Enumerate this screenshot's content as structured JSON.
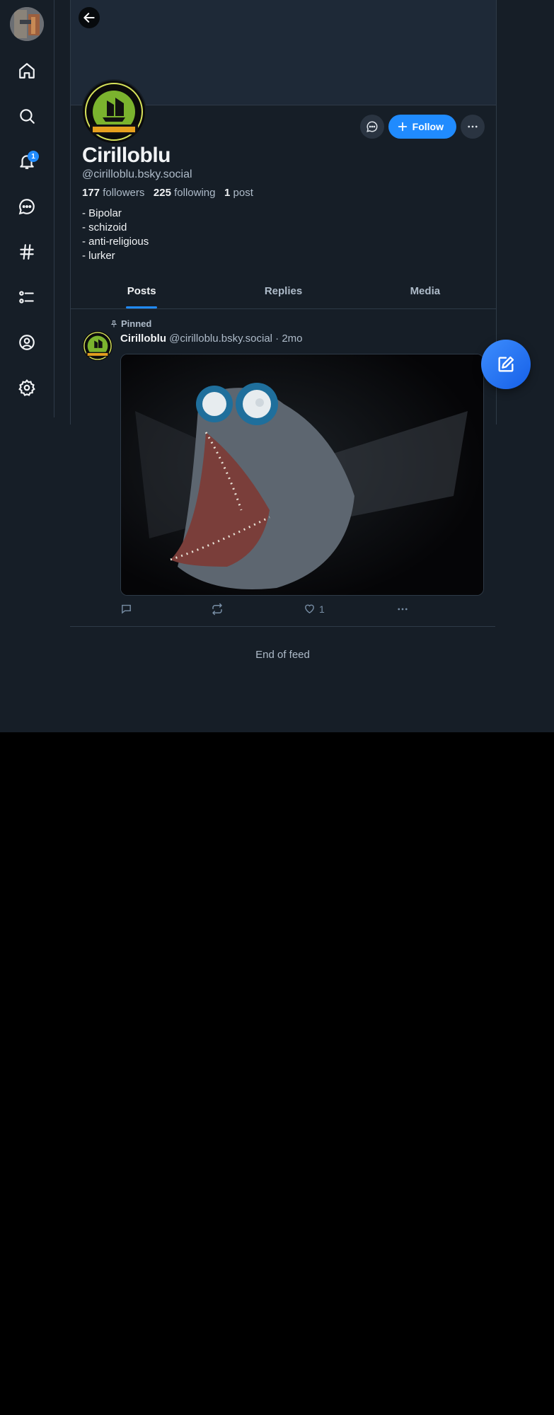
{
  "nav": {
    "notifications_badge": "1",
    "items": [
      "home-icon",
      "search-icon",
      "bell-icon",
      "chat-icon",
      "hashtag-icon",
      "list-icon",
      "profile-icon",
      "gear-icon"
    ]
  },
  "profile": {
    "display_name": "Cirilloblu",
    "handle": "@cirilloblu.bsky.social",
    "followers_count": "177",
    "followers_label": "followers",
    "following_count": "225",
    "following_label": "following",
    "posts_count": "1",
    "posts_label": "post",
    "bio": "- Bipolar\n- schizoid\n- anti-religious\n- lurker",
    "follow_label": "Follow"
  },
  "tabs": [
    {
      "label": "Posts",
      "active": true
    },
    {
      "label": "Replies",
      "active": false
    },
    {
      "label": "Media",
      "active": false
    }
  ],
  "post": {
    "pinned_label": "Pinned",
    "author_name": "Cirilloblu",
    "author_handle": "@cirilloblu.bsky.social",
    "separator": "·",
    "time": "2mo",
    "like_count": "1"
  },
  "feed": {
    "end_text": "End of feed"
  },
  "colors": {
    "accent": "#208bfe",
    "background": "#161e27",
    "banner": "#1e2937",
    "text_muted": "#aebbc9"
  }
}
